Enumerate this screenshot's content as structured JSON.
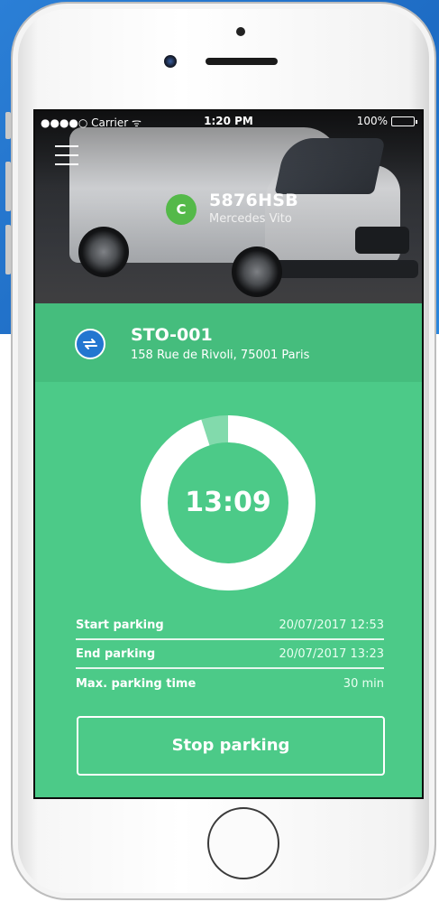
{
  "status_bar": {
    "carrier": "●●●●○ Carrier ᯤ",
    "time": "1:20 PM",
    "battery": "100%"
  },
  "vehicle": {
    "badge": "C",
    "plate": "5876HSB",
    "model": "Mercedes Vito",
    "badge_color": "#54b949"
  },
  "location": {
    "code": "STO-001",
    "address": "158 Rue de Rivoli, 75001 Paris",
    "swap_icon": "swap-arrows-icon"
  },
  "timer": {
    "display": "13:09",
    "elapsed_fraction": 0.95
  },
  "parking": {
    "rows": [
      {
        "label": "Start parking",
        "value": "20/07/2017 12:53"
      },
      {
        "label": "End parking",
        "value": "20/07/2017 13:23"
      },
      {
        "label": "Max. parking time",
        "value": "30 min"
      }
    ]
  },
  "actions": {
    "stop_label": "Stop parking"
  },
  "colors": {
    "accent_green": "#4cca88",
    "location_green": "#45bd7d",
    "swap_blue": "#2376d0"
  }
}
